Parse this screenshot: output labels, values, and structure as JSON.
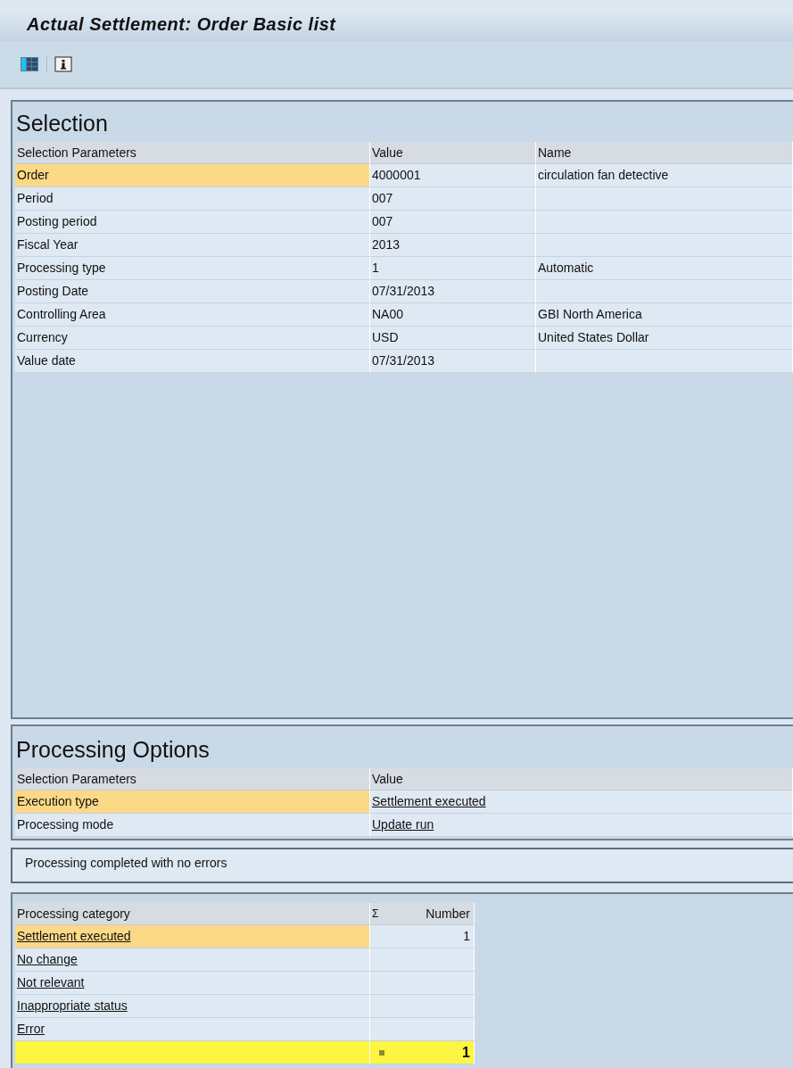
{
  "window": {
    "title": "Actual Settlement: Order Basic list"
  },
  "selection": {
    "title": "Selection",
    "columns": [
      "Selection Parameters",
      "Value",
      "Name"
    ],
    "rows": [
      {
        "cells": [
          "Order",
          "4000001",
          "circulation fan detective"
        ],
        "selected": true
      },
      {
        "cells": [
          "Period",
          "007",
          ""
        ],
        "selected": false
      },
      {
        "cells": [
          "Posting period",
          "007",
          ""
        ],
        "selected": false
      },
      {
        "cells": [
          "Fiscal Year",
          "2013",
          ""
        ],
        "selected": false
      },
      {
        "cells": [
          "Processing type",
          "1",
          "Automatic"
        ],
        "selected": false
      },
      {
        "cells": [
          "Posting Date",
          "07/31/2013",
          ""
        ],
        "selected": false
      },
      {
        "cells": [
          "Controlling Area",
          "NA00",
          "GBI North America"
        ],
        "selected": false
      },
      {
        "cells": [
          "Currency",
          "USD",
          "United States Dollar"
        ],
        "selected": false
      },
      {
        "cells": [
          "Value date",
          "07/31/2013",
          ""
        ],
        "selected": false
      }
    ]
  },
  "processing_options": {
    "title": "Processing Options",
    "columns": [
      "Selection Parameters",
      "Value"
    ],
    "rows": [
      {
        "cells": [
          "Execution type",
          "Settlement executed"
        ],
        "selected": true
      },
      {
        "cells": [
          "Processing mode",
          "Update run"
        ],
        "selected": false
      }
    ]
  },
  "message": "Processing completed with no errors",
  "categories": {
    "columns": [
      "Processing category",
      "Σ",
      "Number"
    ],
    "rows": [
      {
        "label": "Settlement executed",
        "number": "1",
        "selected": true
      },
      {
        "label": "No change",
        "number": "",
        "selected": false
      },
      {
        "label": "Not relevant",
        "number": "",
        "selected": false
      },
      {
        "label": "Inappropriate status",
        "number": "",
        "selected": false
      },
      {
        "label": "Error",
        "number": "",
        "selected": false
      }
    ],
    "total": "1"
  }
}
